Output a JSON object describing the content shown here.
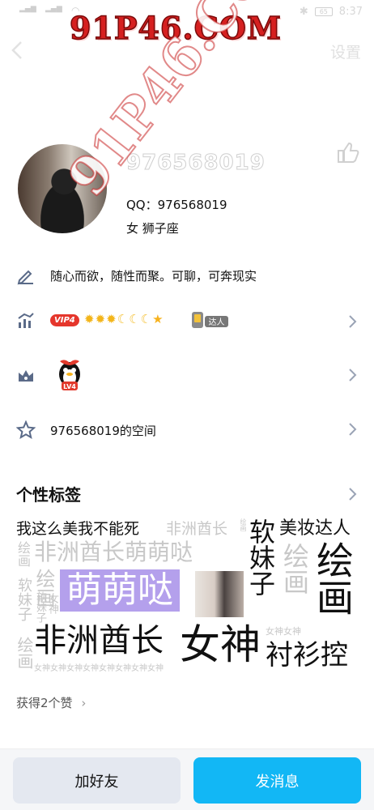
{
  "status_bar": {
    "time": "8:37",
    "battery": "65"
  },
  "watermark": {
    "text": "91P46.COM"
  },
  "header": {
    "settings_label": "设置"
  },
  "profile": {
    "username": "976568019",
    "qq_line": "QQ：976568019",
    "gender_line": "女  狮子座"
  },
  "rows": {
    "signature": "随心而欲，随性而聚。可聊，可奔现实",
    "vip_label": "VIP4",
    "daren_label": "达人",
    "pet_level": "LV4",
    "space_label": "976568019的空间"
  },
  "tags_section": {
    "title": "个性标签",
    "tags": {
      "t1": "我这么美我不能死",
      "t2": "非洲酋长",
      "t3": "绘画",
      "t4": "软妹子",
      "t5": "美妆达人",
      "t6": "绘画",
      "t7": "非洲酋长萌萌哒",
      "t8": "绘画",
      "t9": "绘画",
      "t10": "软妹子",
      "t11": "女神女神",
      "t12": "绘画",
      "t13": "萌萌哒",
      "t14": "软妹子",
      "t15": "女神",
      "t16": "非洲酋长",
      "t17": "女神",
      "t18": "女神女神",
      "t19": "衬衫控",
      "t20": "绘画",
      "t21": "女神女神女神女神女神女神女神女神"
    }
  },
  "likes": {
    "label": "获得2个赞"
  },
  "bottom": {
    "add_friend": "加好友",
    "send_message": "发消息"
  },
  "colors": {
    "accent": "#12b7f5",
    "tag_highlight": "#b4a0ec",
    "vip": "#e5362c"
  }
}
